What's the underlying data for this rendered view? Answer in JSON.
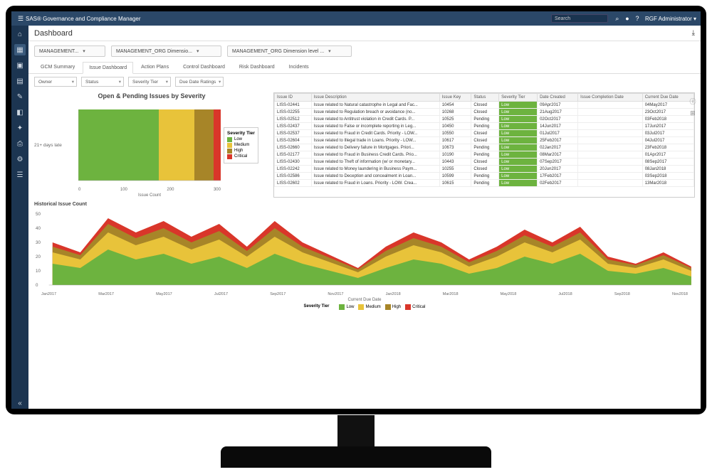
{
  "app_title": "SAS® Governance and Compliance Manager",
  "search_placeholder": "Search",
  "user_name": "RGF Administrator",
  "page_title": "Dashboard",
  "filter1": "MANAGEMENT...",
  "filter2": "MANAGEMENT_ORG Dimensio...",
  "filter3": "MANAGEMENT_ORG Dimension level ...",
  "tabs": [
    "GCM Summary",
    "Issue Dashboard",
    "Action Plans",
    "Control Dashboard",
    "Risk Dashboard",
    "Incidents"
  ],
  "active_tab": 1,
  "subfilters": [
    "Owner",
    "Status",
    "Severity Tier",
    "Due Date Ratings"
  ],
  "severity_chart": {
    "title": "Open & Pending Issues by Severity",
    "ylabel": "21+ days late",
    "xlabel": "Issue Count",
    "legend_title": "Severity Tier",
    "legend": [
      {
        "label": "Low",
        "color": "#6db33f"
      },
      {
        "label": "Medium",
        "color": "#e8c33a"
      },
      {
        "label": "High",
        "color": "#a78528"
      },
      {
        "label": "Critical",
        "color": "#d9362a"
      }
    ],
    "xticks": [
      "0",
      "100",
      "200",
      "300"
    ]
  },
  "table": {
    "headers": [
      "Issue ID",
      "Issue Description",
      "Issue Key",
      "Status",
      "Severity Tier",
      "Date Created",
      "Issue Completion Date",
      "Current Due Date"
    ],
    "rows": [
      [
        "LISS-02441",
        "Issue related to Natural catastrophe in Legal and Fac...",
        "10454",
        "Closed",
        "Low",
        "09Apr2017",
        "",
        "04May2017"
      ],
      [
        "LISS-02255",
        "Issue related to Regulation breach or avoidance (no...",
        "10268",
        "Closed",
        "Low",
        "21Aug2017",
        "",
        "23Oct2017"
      ],
      [
        "LISS-02512",
        "Issue related to Antitrust violation in Credit Cards. P...",
        "10525",
        "Pending",
        "Low",
        "02Oct2017",
        "",
        "03Feb2018"
      ],
      [
        "LISS-02437",
        "Issue related to False or incomplete reporting in Leg...",
        "10450",
        "Pending",
        "Low",
        "14Jun2017",
        "",
        "17Jun2017"
      ],
      [
        "LISS-02537",
        "Issue related to Fraud in Credit Cards. Priority - LOW...",
        "10550",
        "Closed",
        "Low",
        "01Jul2017",
        "",
        "03Jul2017"
      ],
      [
        "LISS-02604",
        "Issue related to Illegal trade in Loans. Priority - LOW...",
        "10617",
        "Closed",
        "Low",
        "25Feb2017",
        "",
        "04Jul2017"
      ],
      [
        "LISS-02660",
        "Issue related to Delivery failure in Mortgages. Priori...",
        "10673",
        "Pending",
        "Low",
        "02Jan2017",
        "",
        "23Feb2018"
      ],
      [
        "LISS-02177",
        "Issue related to Fraud in Business Credit Cards. Prio...",
        "10190",
        "Pending",
        "Low",
        "08Mar2017",
        "",
        "01Apr2017"
      ],
      [
        "LISS-02430",
        "Issue related to Theft of information (w/ or monetary...",
        "10443",
        "Closed",
        "Low",
        "07Sep2017",
        "",
        "08Sep2017"
      ],
      [
        "LISS-02242",
        "Issue related to Money laundering in Business Paym...",
        "10255",
        "Closed",
        "Low",
        "20Jun2017",
        "",
        "08Jan2018"
      ],
      [
        "LISS-02586",
        "Issue related to Deception and concealment in Loan...",
        "10599",
        "Pending",
        "Low",
        "17Feb2017",
        "",
        "03Sep2018"
      ],
      [
        "LISS-02602",
        "Issue related to Fraud in Loans. Priority - LOW. Crea...",
        "10615",
        "Pending",
        "Low",
        "02Feb2017",
        "",
        "13Mar2018"
      ]
    ]
  },
  "hist": {
    "title": "Historical Issue Count",
    "yticks": [
      "50",
      "40",
      "30",
      "20",
      "10",
      "0"
    ],
    "xticks": [
      "Jan2017",
      "Mar2017",
      "May2017",
      "Jul2017",
      "Sep2017",
      "Nov2017",
      "Jan2018",
      "Mar2018",
      "May2018",
      "Jul2018",
      "Sep2018",
      "Nov2018"
    ],
    "xlabel": "Current Due Date",
    "legend_title": "Severity Tier",
    "legend": [
      {
        "label": "Low",
        "color": "#6db33f"
      },
      {
        "label": "Medium",
        "color": "#e8c33a"
      },
      {
        "label": "High",
        "color": "#a78528"
      },
      {
        "label": "Critical",
        "color": "#d9362a"
      }
    ]
  },
  "chart_data": [
    {
      "type": "bar",
      "title": "Open & Pending Issues by Severity",
      "categories": [
        "21+ days late"
      ],
      "series": [
        {
          "name": "Low",
          "values": [
            170
          ]
        },
        {
          "name": "Medium",
          "values": [
            75
          ]
        },
        {
          "name": "High",
          "values": [
            40
          ]
        },
        {
          "name": "Critical",
          "values": [
            25
          ]
        }
      ],
      "xlabel": "Issue Count",
      "ylabel": "",
      "xlim": [
        0,
        300
      ]
    },
    {
      "type": "area",
      "title": "Historical Issue Count",
      "x": [
        "Jan2017",
        "Feb2017",
        "Mar2017",
        "Apr2017",
        "May2017",
        "Jun2017",
        "Jul2017",
        "Aug2017",
        "Sep2017",
        "Oct2017",
        "Nov2017",
        "Dec2017",
        "Jan2018",
        "Feb2018",
        "Mar2018",
        "Apr2018",
        "May2018",
        "Jun2018",
        "Jul2018",
        "Aug2018",
        "Sep2018",
        "Oct2018",
        "Nov2018",
        "Dec2018"
      ],
      "series": [
        {
          "name": "Low",
          "values": [
            15,
            12,
            25,
            18,
            22,
            15,
            20,
            12,
            22,
            15,
            10,
            5,
            12,
            18,
            15,
            8,
            12,
            20,
            15,
            22,
            10,
            8,
            12,
            6
          ]
        },
        {
          "name": "Medium",
          "values": [
            8,
            6,
            12,
            10,
            12,
            10,
            12,
            8,
            12,
            8,
            6,
            4,
            8,
            10,
            8,
            5,
            8,
            10,
            8,
            10,
            5,
            4,
            6,
            4
          ]
        },
        {
          "name": "High",
          "values": [
            4,
            3,
            6,
            5,
            6,
            5,
            6,
            4,
            6,
            4,
            3,
            2,
            4,
            5,
            4,
            3,
            4,
            5,
            4,
            5,
            3,
            2,
            3,
            2
          ]
        },
        {
          "name": "Critical",
          "values": [
            3,
            2,
            4,
            4,
            5,
            4,
            5,
            3,
            5,
            3,
            2,
            1,
            3,
            4,
            3,
            2,
            3,
            4,
            3,
            4,
            2,
            1,
            2,
            1
          ]
        }
      ],
      "xlabel": "Current Due Date",
      "ylabel": "",
      "ylim": [
        0,
        50
      ]
    }
  ]
}
